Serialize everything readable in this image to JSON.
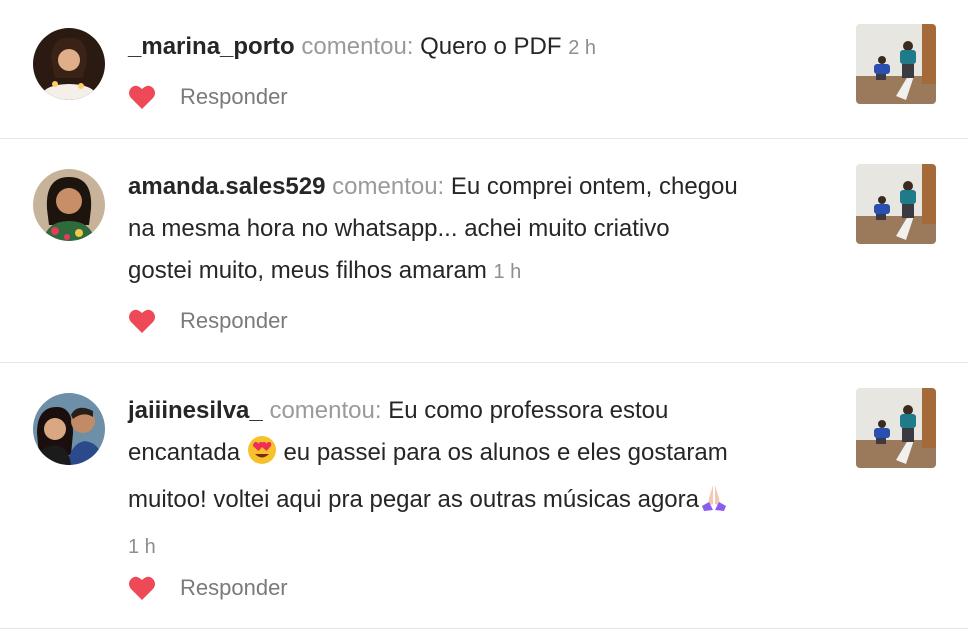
{
  "comments": [
    {
      "username": "_marina_porto",
      "verb": "comentou:",
      "text": "Quero o PDF",
      "time": "2 h",
      "reply_label": "Responder"
    },
    {
      "username": "amanda.sales529",
      "verb": "comentou:",
      "text_line1": "Eu comprei ontem, chegou",
      "text_line2": "na mesma hora no whatsapp... achei muito criativo",
      "text_line3": "gostei muito, meus filhos amaram",
      "time": "1 h",
      "reply_label": "Responder"
    },
    {
      "username": "jaiiinesilva_",
      "verb": "comentou:",
      "text_line1": "Eu como professora estou",
      "text_line2a": "encantada",
      "text_line2b": "eu passei para os alunos e eles gostaram",
      "text_line3": "muitoo! voltei aqui pra pegar as outras músicas agora",
      "time": "1 h",
      "reply_label": "Responder"
    }
  ],
  "icons": {
    "like": "heart-icon",
    "emoji_heart_eyes": "heart-eyes-emoji",
    "emoji_pray": "praying-hands-emoji"
  },
  "colors": {
    "heart": "#ed4956",
    "verb": "#9a9a9a",
    "divider": "#e6e6e6"
  }
}
